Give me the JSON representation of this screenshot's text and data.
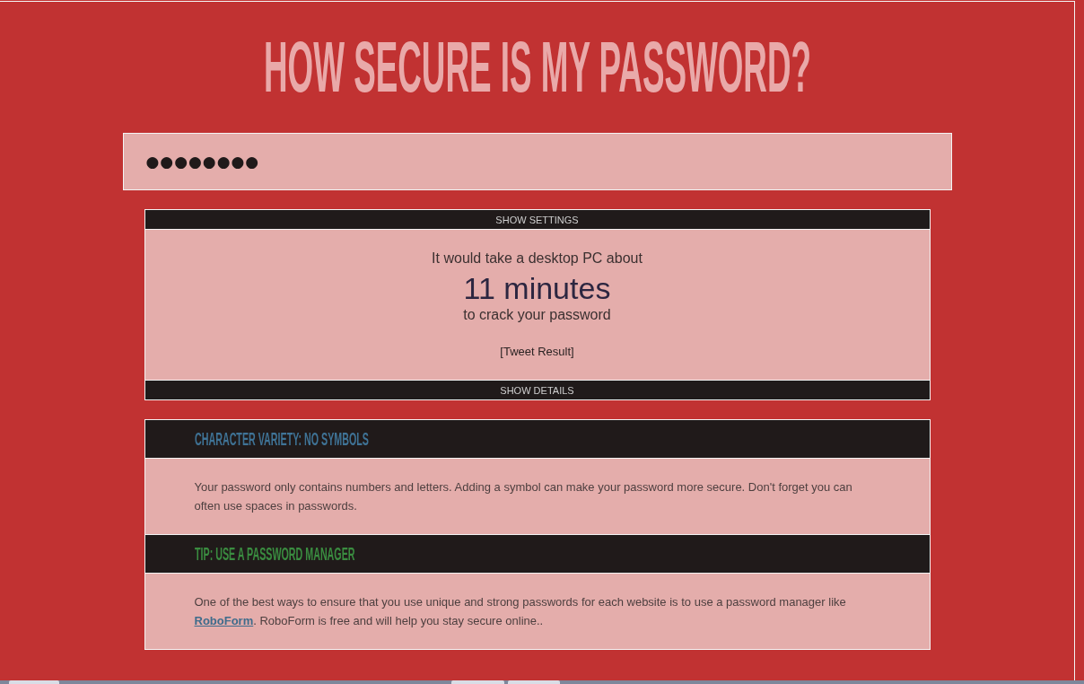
{
  "title": "HOW SECURE IS MY PASSWORD?",
  "password_field": {
    "value": "●●●●●●●●"
  },
  "result_panel": {
    "settings_toggle": "SHOW SETTINGS",
    "lead": "It would take a desktop PC about",
    "time": "11 minutes",
    "trail": "to crack your password",
    "tweet_link": "[Tweet Result]",
    "details_toggle": "SHOW DETAILS"
  },
  "details": [
    {
      "kind": "warning",
      "heading": "CHARACTER VARIETY: NO SYMBOLS",
      "body": [
        {
          "kind": "text",
          "text": "Your password only contains numbers and letters. Adding a symbol can make your password more secure. Don't forget you can often use spaces in passwords."
        }
      ]
    },
    {
      "kind": "tip",
      "heading": "TIP: USE A PASSWORD MANAGER",
      "body": [
        {
          "kind": "text",
          "text": "One of the best ways to ensure that you use unique and strong passwords for each website is to use a password manager like "
        },
        {
          "kind": "link",
          "text": "RoboForm"
        },
        {
          "kind": "text",
          "text": ". RoboForm is free and will help you stay secure online.."
        }
      ]
    }
  ]
}
